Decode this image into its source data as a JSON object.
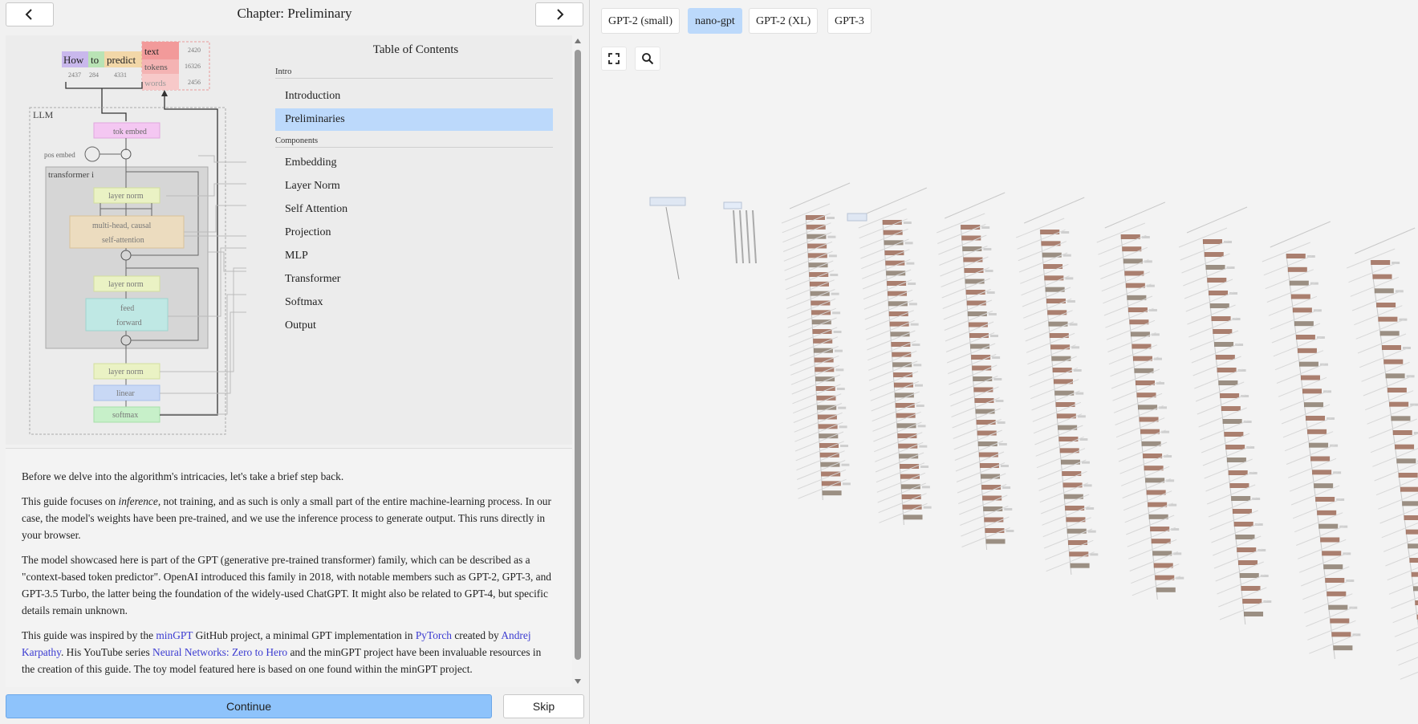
{
  "header": {
    "chapter_title": "Chapter: Preliminary",
    "prev_icon": "chevron-left-icon",
    "next_icon": "chevron-right-icon"
  },
  "figure": {
    "tokens": [
      {
        "word": "How",
        "id": "2437",
        "color": "#c9b8ec"
      },
      {
        "word": "to",
        "id": "284",
        "color": "#b9e3b5"
      },
      {
        "word": "predict",
        "id": "4331",
        "color": "#f2d7a8"
      }
    ],
    "output_words": [
      {
        "word": "text",
        "id": "2420"
      },
      {
        "word": "tokens",
        "id": "16326"
      },
      {
        "word": "words",
        "id": "2456"
      }
    ],
    "llm_label": "LLM",
    "pos_embed_label": "pos embed",
    "transformer_label": "transformer i",
    "blocks": {
      "tok_embed": "tok embed",
      "layer_norm": "layer norm",
      "attention_line1": "multi-head, causal",
      "attention_line2": "self-attention",
      "feed": "feed",
      "forward": "forward",
      "linear": "linear",
      "softmax": "softmax"
    }
  },
  "toc": {
    "title": "Table of Contents",
    "sections": [
      {
        "name": "Intro",
        "items": [
          "Introduction",
          "Preliminaries"
        ]
      },
      {
        "name": "Components",
        "items": [
          "Embedding",
          "Layer Norm",
          "Self Attention",
          "Projection",
          "MLP",
          "Transformer",
          "Softmax",
          "Output"
        ]
      }
    ],
    "active_item": "Preliminaries"
  },
  "content": {
    "p1": "Before we delve into the algorithm's intricacies, let's take a brief step back.",
    "p2_a": "This guide focuses on ",
    "p2_em": "inference",
    "p2_b": ", not training, and as such is only a small part of the entire machine-learning process. In our case, the model's weights have been pre-trained, and we use the inference process to generate output. This runs directly in your browser.",
    "p3": "The model showcased here is part of the GPT (generative pre-trained transformer) family, which can be described as a \"context-based token predictor\". OpenAI introduced this family in 2018, with notable members such as GPT-2, GPT-3, and GPT-3.5 Turbo, the latter being the foundation of the widely-used ChatGPT. It might also be related to GPT-4, but specific details remain unknown.",
    "p4_a": "This guide was inspired by the ",
    "p4_link1": "minGPT",
    "p4_b": " GitHub project, a minimal GPT implementation in ",
    "p4_link2": "PyTorch",
    "p4_c": " created by ",
    "p4_link3": "Andrej Karpathy",
    "p4_d": ". His YouTube series ",
    "p4_link4": "Neural Networks: Zero to Hero",
    "p4_e": " and the minGPT project have been invaluable resources in the creation of this guide. The toy model featured here is based on one found within the minGPT project."
  },
  "footer": {
    "continue_label": "Continue",
    "skip_label": "Skip"
  },
  "models": {
    "buttons": [
      "GPT-2 (small)",
      "nano-gpt",
      "GPT-2 (XL)",
      "GPT-3"
    ],
    "selected": "nano-gpt"
  },
  "tools": {
    "fullscreen_icon": "fullscreen-icon",
    "search_icon": "search-icon"
  }
}
